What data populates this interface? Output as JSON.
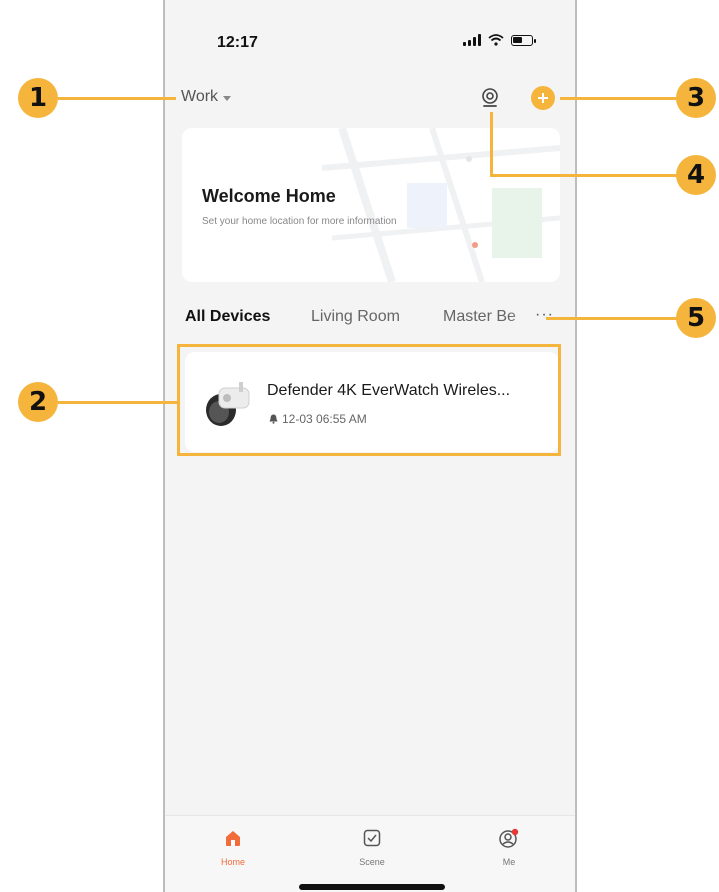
{
  "status_bar": {
    "time": "12:17"
  },
  "header": {
    "home_name": "Work"
  },
  "welcome_card": {
    "title": "Welcome Home",
    "subtitle": "Set your home location for more information"
  },
  "room_tabs": [
    "All Devices",
    "Living Room",
    "Master Be"
  ],
  "more_label": "···",
  "device": {
    "name": "Defender 4K EverWatch Wireles...",
    "last_event": "12-03 06:55 AM"
  },
  "tab_bar": [
    {
      "label": "Home",
      "icon": "home-icon"
    },
    {
      "label": "Scene",
      "icon": "scene-icon"
    },
    {
      "label": "Me",
      "icon": "profile-icon"
    }
  ],
  "annotations": [
    "1",
    "2",
    "3",
    "4",
    "5"
  ],
  "colors": {
    "accent": "#f5b53c",
    "active_tab": "#f26b3a",
    "background": "#f4f4f4"
  }
}
